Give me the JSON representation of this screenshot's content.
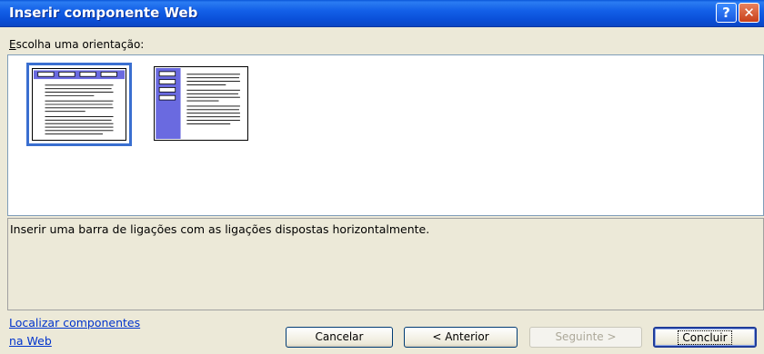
{
  "window": {
    "title": "Inserir componente Web",
    "help_glyph": "?",
    "close_glyph": "✕"
  },
  "orientation": {
    "label": "Escolha uma orientação:",
    "mnemonic": "E",
    "rest": "scolha uma orientação:",
    "options": [
      {
        "id": "horizontal",
        "selected": true
      },
      {
        "id": "vertical",
        "selected": false
      }
    ]
  },
  "description": "Inserir uma barra de ligações com as ligações dispostas horizontalmente.",
  "link": {
    "line1": "Localizar componentes",
    "line2": "na Web"
  },
  "buttons": {
    "cancel": "Cancelar",
    "back": "< Anterior",
    "next": "Seguinte >",
    "finish": "Concluir"
  },
  "colors": {
    "titlebar": "#0a4fd8",
    "selection_border": "#3a6fd0",
    "nav_fill": "#5a5ad8",
    "link": "#0033cc"
  }
}
